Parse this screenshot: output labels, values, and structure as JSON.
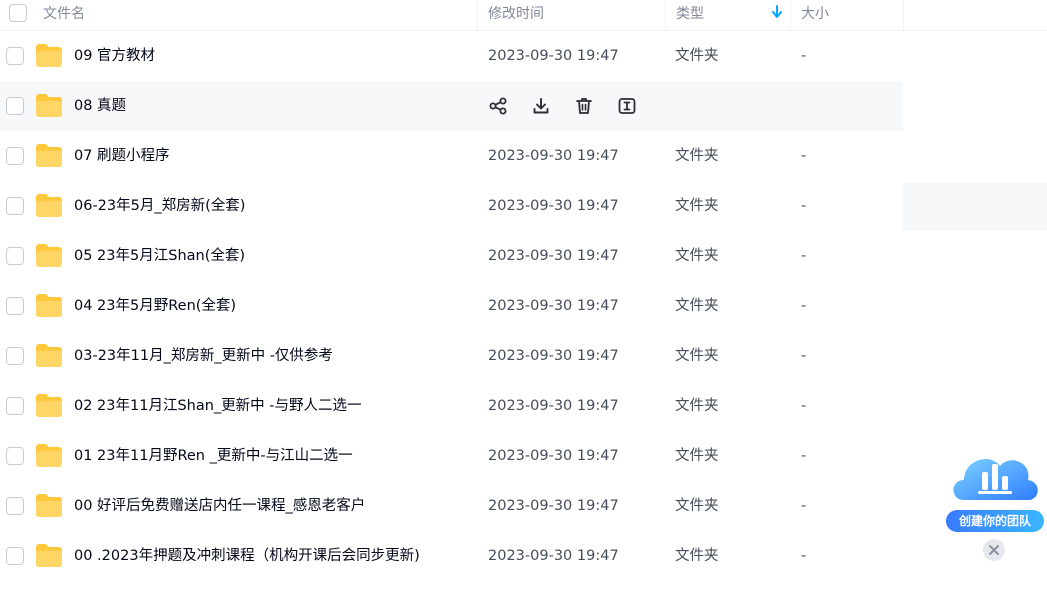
{
  "columns": {
    "name": "文件名",
    "modified": "修改时间",
    "type": "类型",
    "size": "大小"
  },
  "rows": [
    {
      "name": "09 官方教材",
      "modified": "2023-09-30 19:47",
      "type": "文件夹",
      "size": "-"
    },
    {
      "name": "08 真题",
      "modified": "",
      "type": "",
      "size": ""
    },
    {
      "name": "07 刷题小程序",
      "modified": "2023-09-30 19:47",
      "type": "文件夹",
      "size": "-"
    },
    {
      "name": "06-23年5月_郑房新(全套)",
      "modified": "2023-09-30 19:47",
      "type": "文件夹",
      "size": "-"
    },
    {
      "name": "05 23年5月江Shan(全套)",
      "modified": "2023-09-30 19:47",
      "type": "文件夹",
      "size": "-"
    },
    {
      "name": "04 23年5月野Ren(全套)",
      "modified": "2023-09-30 19:47",
      "type": "文件夹",
      "size": "-"
    },
    {
      "name": "03-23年11月_郑房新_更新中 -仅供参考",
      "modified": "2023-09-30 19:47",
      "type": "文件夹",
      "size": "-"
    },
    {
      "name": "02 23年11月江Shan_更新中 -与野人二选一",
      "modified": "2023-09-30 19:47",
      "type": "文件夹",
      "size": "-"
    },
    {
      "name": "01 23年11月野Ren _更新中-与江山二选一",
      "modified": "2023-09-30 19:47",
      "type": "文件夹",
      "size": "-"
    },
    {
      "name": "00 好评后免费赠送店内任一课程_感恩老客户",
      "modified": "2023-09-30 19:47",
      "type": "文件夹",
      "size": "-"
    },
    {
      "name": "00 .2023年押题及冲刺课程（机构开课后会同步更新)",
      "modified": "2023-09-30 19:47",
      "type": "文件夹",
      "size": "-"
    }
  ],
  "hovered_row_actions": [
    "share-icon",
    "download-icon",
    "delete-icon",
    "rename-icon"
  ],
  "sort": {
    "column": "type",
    "direction": "down-arrow-icon"
  },
  "widget": {
    "label": "创建你的团队"
  },
  "colors": {
    "accent": "#06a7ff",
    "folder": "#ffc83d",
    "hover": "#f7f8fa"
  }
}
